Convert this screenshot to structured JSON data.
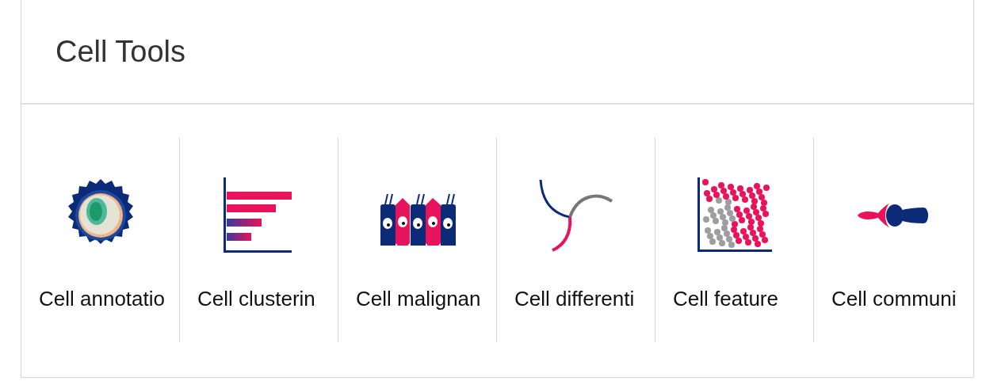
{
  "panel": {
    "title": "Cell Tools"
  },
  "tools": [
    {
      "label": "Cell annotatio"
    },
    {
      "label": "Cell clusterin"
    },
    {
      "label": "Cell malignan"
    },
    {
      "label": "Cell differenti"
    },
    {
      "label": "Cell feature"
    },
    {
      "label": "Cell communi"
    }
  ]
}
